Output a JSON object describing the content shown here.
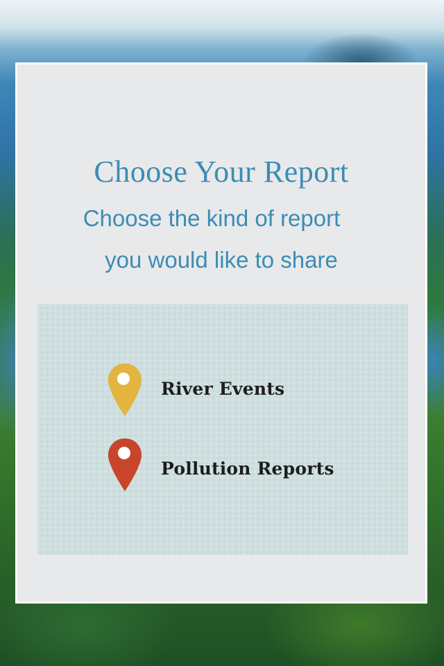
{
  "screen": {
    "title": "Choose Your Report",
    "subtitle_line1": "Choose the kind of report",
    "subtitle_line2": "you would like to share"
  },
  "options": [
    {
      "label": "River Events",
      "icon": "map-pin-icon",
      "color": "#e3b43e"
    },
    {
      "label": "Pollution Reports",
      "icon": "map-pin-icon",
      "color": "#c8452b"
    }
  ],
  "colors": {
    "accent": "#3b8cb6",
    "card_bg": "#e8e9ea",
    "panel_bg": "#cfdfe0"
  }
}
